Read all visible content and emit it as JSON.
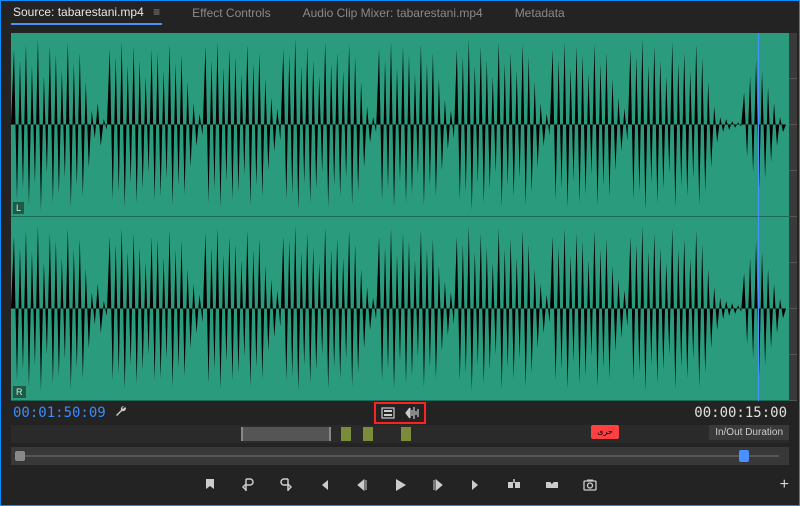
{
  "tabs": {
    "source": "Source: tabarestani.mp4",
    "effect_controls": "Effect Controls",
    "audio_mixer": "Audio Clip Mixer: tabarestani.mp4",
    "metadata": "Metadata"
  },
  "channels": {
    "left_label": "L",
    "right_label": "R"
  },
  "timecode": {
    "current": "00:01:50:09",
    "duration": "00:00:15:00"
  },
  "badges": {
    "in_out_duration": "In/Out Duration",
    "red_marker_text": "حرى"
  },
  "colors": {
    "accent_blue": "#4a90ff",
    "waveform_bg": "#2b9b7e",
    "highlight_red": "#ff2020"
  }
}
